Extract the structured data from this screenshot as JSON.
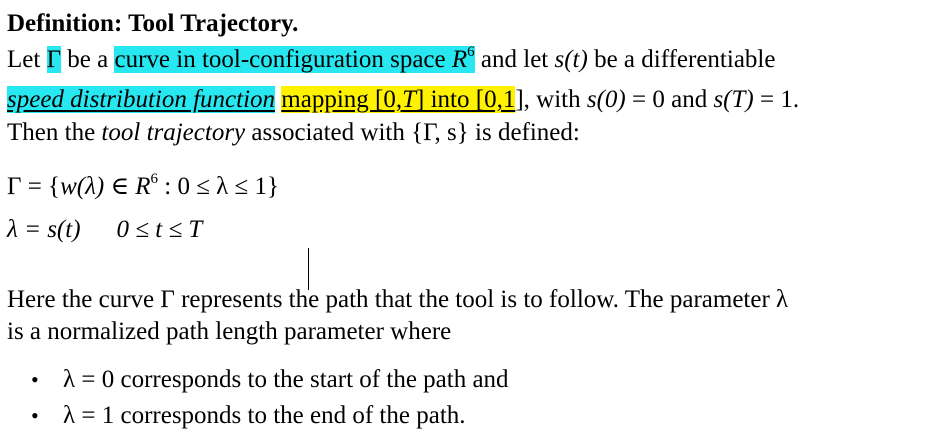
{
  "title": "Definition: Tool Trajectory.",
  "line1": {
    "pre": "Let ",
    "gamma": "Γ",
    "mid": " be a ",
    "hl_text": "curve in tool-configuration space ",
    "hl_R": "R",
    "hl_sup": "6",
    "post1": " and let ",
    "s_t": "s(t)",
    "post2": " be a differentiable"
  },
  "line2": {
    "hl_cyan": "speed distribution function",
    "space": " ",
    "hl_yellow_pre": "mapping [0,",
    "hl_yellow_T": "T",
    "hl_yellow_post": "] into [0,1",
    "post1": "], with ",
    "s0": "s(0)",
    "post2": " = 0 and ",
    "sT": "s(T)",
    "post3": " = 1."
  },
  "line3": {
    "pre": "Then the ",
    "term": "tool trajectory",
    "post": " associated with {Γ, s} is defined:"
  },
  "equation1": {
    "lhs": "Γ = {",
    "w": "w(λ)",
    "in": " ∈ ",
    "R": "R",
    "sup": "6",
    "rest": " : 0 ≤ λ ≤ 1}"
  },
  "equation2": {
    "lhs": "λ = s(t)",
    "rhs": "0 ≤ t ≤ T"
  },
  "para": {
    "line1": "Here the curve Γ represents the path that the tool is to follow. The parameter λ",
    "line2": "is a normalized path length parameter where"
  },
  "bullets": [
    {
      "symbol": "•",
      "text": "λ = 0 corresponds to the start of the path and"
    },
    {
      "symbol": "•",
      "text": "λ = 1 corresponds to the end of the path."
    }
  ]
}
